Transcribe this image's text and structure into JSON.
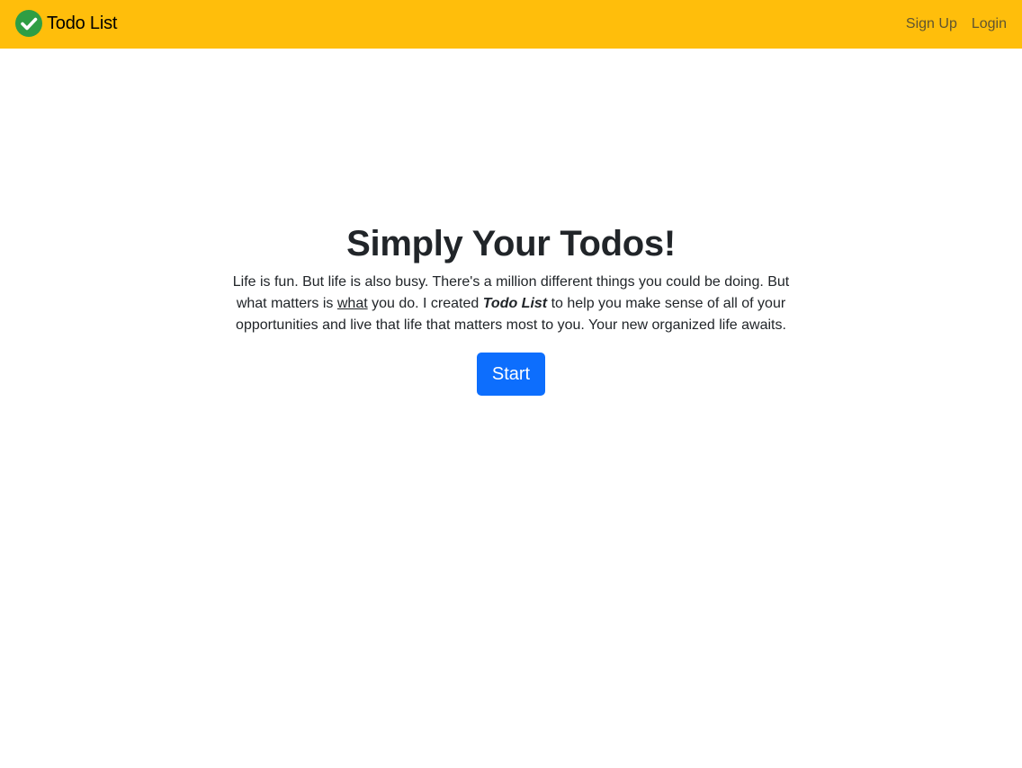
{
  "navbar": {
    "brand": {
      "icon": "check-circle-icon",
      "label": "Todo List"
    },
    "links": [
      {
        "label": "Sign Up"
      },
      {
        "label": "Login"
      }
    ],
    "colors": {
      "background": "#ffbe0b",
      "icon_fill": "#2f9e44",
      "link": "#5f5431"
    }
  },
  "hero": {
    "title": "Simply Your Todos!",
    "text": {
      "part1": "Life is fun. But life is also busy. There's a million different things you could be doing. But what matters is ",
      "emphasis_word": "what",
      "part2": " you do. I created ",
      "app_name": "Todo List",
      "part3": " to help you make sense of all of your opportunities and live that life that matters most to you. Your new organized life awaits."
    },
    "start_label": "Start",
    "colors": {
      "button": "#0d6efd",
      "text": "#212529"
    }
  }
}
